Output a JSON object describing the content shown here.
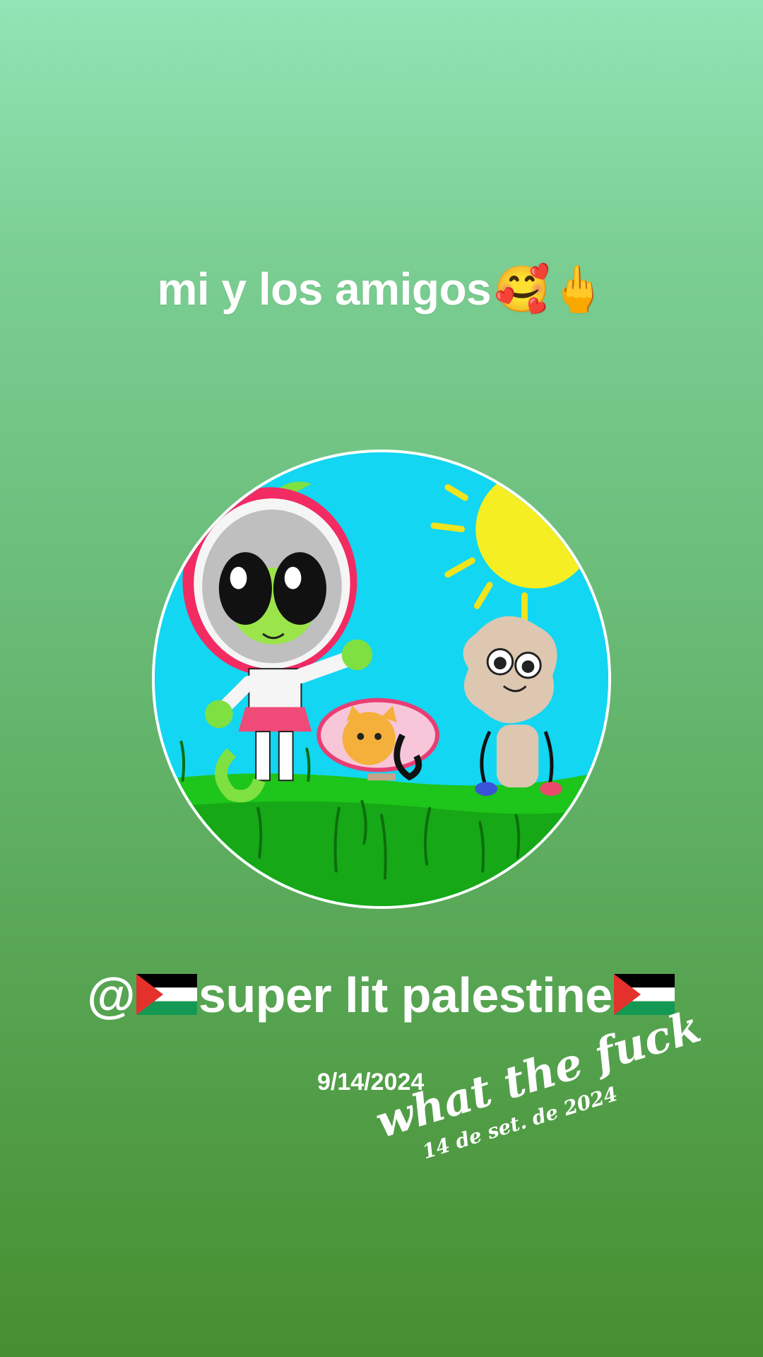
{
  "story": {
    "title_text": "mi y los amigos",
    "title_emojis": "🥰🖕",
    "mention_at": "@",
    "mention_name": "super lit palestine",
    "date_text": "9/14/2024",
    "sticker_main": "what the fuck",
    "sticker_date": "14 de set. de 2024"
  },
  "colors": {
    "background_top": "#91e5b6",
    "background_bottom": "#468e2f",
    "text": "#ffffff",
    "flag_black": "#000000",
    "flag_white": "#ffffff",
    "flag_green": "#149954",
    "flag_red": "#e4312b"
  },
  "icons": {
    "title_emoji_1": "smiling-face-with-hearts-emoji",
    "title_emoji_2": "middle-finger-emoji",
    "mention_flag": "palestine-flag-icon"
  }
}
